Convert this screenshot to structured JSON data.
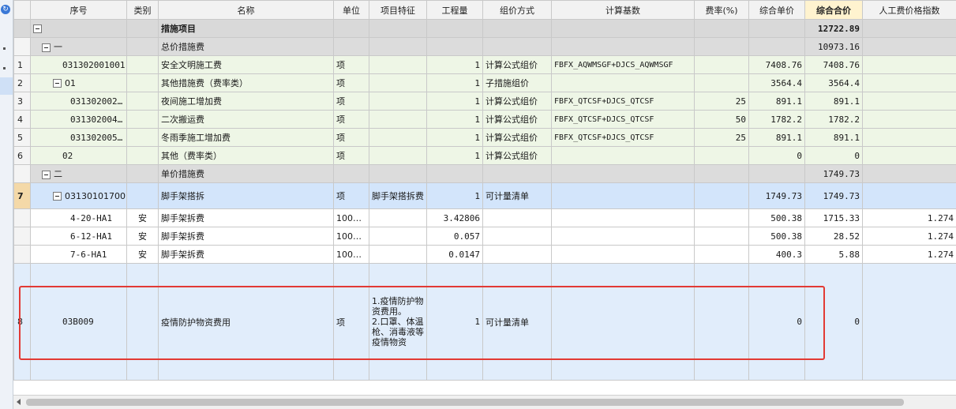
{
  "columns": [
    "序号",
    "类别",
    "名称",
    "单位",
    "项目特征",
    "工程量",
    "组价方式",
    "计算基数",
    "费率(%)",
    "综合单价",
    "综合合价",
    "人工费价格指数"
  ],
  "active_column": "综合合价",
  "rows": [
    {
      "seq": "",
      "code": "",
      "type": "",
      "name": "措施项目",
      "unit": "",
      "feature": "",
      "qty": "",
      "method": "",
      "base": "",
      "rate": "",
      "unit_price": "",
      "total": "12722.89",
      "labor_index": ""
    },
    {
      "seq": "",
      "code": "一",
      "type": "",
      "name": "总价措施费",
      "unit": "",
      "feature": "",
      "qty": "",
      "method": "",
      "base": "",
      "rate": "",
      "unit_price": "",
      "total": "10973.16",
      "labor_index": ""
    },
    {
      "seq": "1",
      "code": "031302001001",
      "type": "",
      "name": "安全文明施工费",
      "unit": "项",
      "feature": "",
      "qty": "1",
      "method": "计算公式组价",
      "base": "FBFX_AQWMSGF+DJCS_AQWMSGF",
      "rate": "",
      "unit_price": "7408.76",
      "total": "7408.76",
      "labor_index": ""
    },
    {
      "seq": "2",
      "code": "01",
      "type": "",
      "name": "其他措施费（费率类）",
      "unit": "项",
      "feature": "",
      "qty": "1",
      "method": "子措施组价",
      "base": "",
      "rate": "",
      "unit_price": "3564.4",
      "total": "3564.4",
      "labor_index": ""
    },
    {
      "seq": "3",
      "code": "031302002…",
      "type": "",
      "name": "夜间施工增加费",
      "unit": "项",
      "feature": "",
      "qty": "1",
      "method": "计算公式组价",
      "base": "FBFX_QTCSF+DJCS_QTCSF",
      "rate": "25",
      "unit_price": "891.1",
      "total": "891.1",
      "labor_index": ""
    },
    {
      "seq": "4",
      "code": "031302004…",
      "type": "",
      "name": "二次搬运费",
      "unit": "项",
      "feature": "",
      "qty": "1",
      "method": "计算公式组价",
      "base": "FBFX_QTCSF+DJCS_QTCSF",
      "rate": "50",
      "unit_price": "1782.2",
      "total": "1782.2",
      "labor_index": ""
    },
    {
      "seq": "5",
      "code": "031302005…",
      "type": "",
      "name": "冬雨季施工增加费",
      "unit": "项",
      "feature": "",
      "qty": "1",
      "method": "计算公式组价",
      "base": "FBFX_QTCSF+DJCS_QTCSF",
      "rate": "25",
      "unit_price": "891.1",
      "total": "891.1",
      "labor_index": ""
    },
    {
      "seq": "6",
      "code": "02",
      "type": "",
      "name": "其他（费率类）",
      "unit": "项",
      "feature": "",
      "qty": "1",
      "method": "计算公式组价",
      "base": "",
      "rate": "",
      "unit_price": "0",
      "total": "0",
      "labor_index": ""
    },
    {
      "seq": "",
      "code": "二",
      "type": "",
      "name": "单价措施费",
      "unit": "",
      "feature": "",
      "qty": "",
      "method": "",
      "base": "",
      "rate": "",
      "unit_price": "",
      "total": "1749.73",
      "labor_index": ""
    },
    {
      "seq": "7",
      "code": "031301017001",
      "type": "",
      "name": "脚手架搭拆",
      "unit": "项",
      "feature": "脚手架搭拆费",
      "qty": "1",
      "method": "可计量清单",
      "base": "",
      "rate": "",
      "unit_price": "1749.73",
      "total": "1749.73",
      "labor_index": ""
    },
    {
      "seq": "",
      "code": "4-20-HA1",
      "type": "安",
      "name": "脚手架拆费",
      "unit": "100…",
      "feature": "",
      "qty": "3.42806",
      "method": "",
      "base": "",
      "rate": "",
      "unit_price": "500.38",
      "total": "1715.33",
      "labor_index": "1.274"
    },
    {
      "seq": "",
      "code": "6-12-HA1",
      "type": "安",
      "name": "脚手架拆费",
      "unit": "100…",
      "feature": "",
      "qty": "0.057",
      "method": "",
      "base": "",
      "rate": "",
      "unit_price": "500.38",
      "total": "28.52",
      "labor_index": "1.274"
    },
    {
      "seq": "",
      "code": "7-6-HA1",
      "type": "安",
      "name": "脚手架拆费",
      "unit": "100…",
      "feature": "",
      "qty": "0.0147",
      "method": "",
      "base": "",
      "rate": "",
      "unit_price": "400.3",
      "total": "5.88",
      "labor_index": "1.274"
    },
    {
      "seq": "8",
      "code": "03B009",
      "type": "",
      "name": "疫情防护物资费用",
      "unit": "项",
      "feature": "1.疫情防护物资费用。\n2.口罩、体温枪、消毒液等疫情物资",
      "qty": "1",
      "method": "可计量清单",
      "base": "",
      "rate": "",
      "unit_price": "0",
      "total": "0",
      "labor_index": ""
    }
  ],
  "icons": {
    "strip_top": "refresh-icon",
    "toggle": "collapse-toggle-icon",
    "scroll_left": "arrow-left-icon"
  },
  "colors": {
    "highlight_border": "#e23a34",
    "selected_row": "#d3e5fb",
    "group_row": "#dcdcdc",
    "green_row": "#eef6e6"
  }
}
